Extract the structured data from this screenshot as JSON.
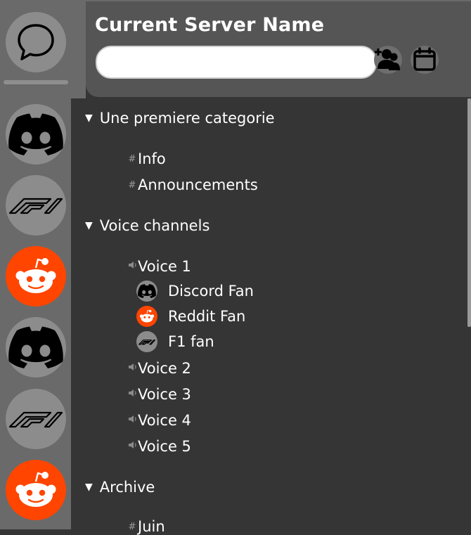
{
  "header": {
    "server_name": "Current Server Name",
    "search_value": "",
    "icons": [
      "add-friend-icon",
      "calendar-icon"
    ]
  },
  "rail": {
    "servers": [
      {
        "name": "messages",
        "icon": "chat-bubble-icon"
      },
      {
        "name": "discord",
        "icon": "discord-icon"
      },
      {
        "name": "f1",
        "icon": "f1-icon"
      },
      {
        "name": "reddit",
        "icon": "reddit-icon"
      },
      {
        "name": "discord",
        "icon": "discord-icon"
      },
      {
        "name": "f1",
        "icon": "f1-icon"
      },
      {
        "name": "reddit",
        "icon": "reddit-icon"
      }
    ]
  },
  "categories": [
    {
      "label": "Une premiere categorie",
      "arrow": "▼"
    },
    {
      "label": "Voice channels",
      "arrow": "▼"
    },
    {
      "label": "Archive",
      "arrow": "▼"
    }
  ],
  "text_channels": [
    {
      "prefix": "#",
      "label": "Info"
    },
    {
      "prefix": "#",
      "label": "Announcements"
    }
  ],
  "voice_channels": [
    {
      "label": "Voice 1"
    },
    {
      "label": "Voice 2"
    },
    {
      "label": "Voice 3"
    },
    {
      "label": "Voice 4"
    },
    {
      "label": "Voice 5"
    }
  ],
  "voice_users": [
    {
      "label": "Discord Fan",
      "avatar": "discord-icon"
    },
    {
      "label": "Reddit Fan",
      "avatar": "reddit-icon"
    },
    {
      "label": "F1 fan",
      "avatar": "f1-icon"
    }
  ],
  "archive_channels": [
    {
      "prefix": "#",
      "label": "Juin"
    }
  ],
  "colors": {
    "background": "#353535",
    "rail": "#6a6a6a",
    "header": "#555555",
    "reddit": "#ff4500"
  }
}
